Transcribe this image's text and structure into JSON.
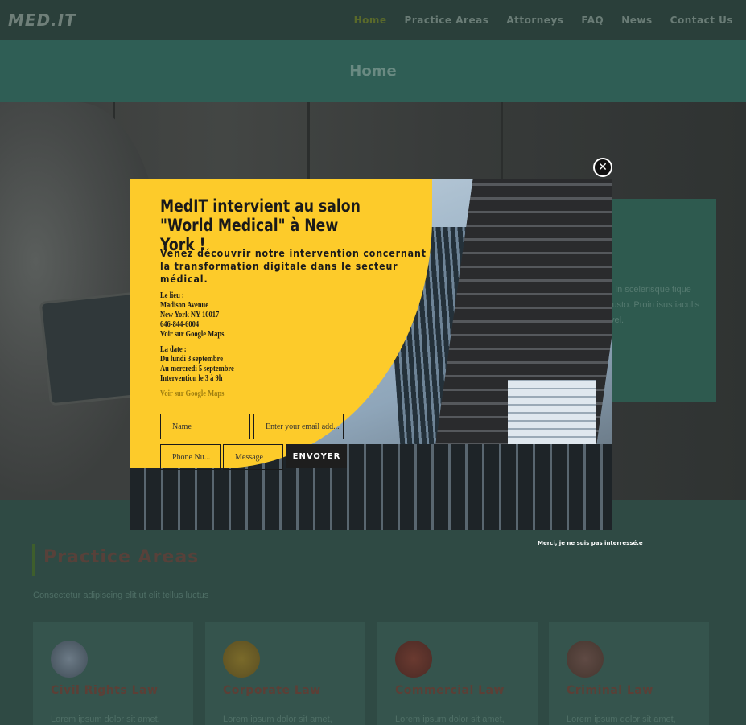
{
  "header": {
    "logo": "MED.IT",
    "nav": [
      "Home",
      "Practice Areas",
      "Attorneys",
      "FAQ",
      "News",
      "Contact Us"
    ],
    "active_nav": "Home"
  },
  "page_title": "Home",
  "hero_card": {
    "text": ". In scelerisque tique justo. Proin isus iaculis vel."
  },
  "practice": {
    "title": "Practice Areas",
    "subtitle": "Consectetur adipiscing elit ut elit tellus luctus",
    "cards": [
      {
        "title": "Civil Rights Law",
        "desc": "Lorem ipsum dolor sit amet,",
        "icon": "dove-icon"
      },
      {
        "title": "Corporate Law",
        "desc": "Lorem ipsum dolor sit amet,",
        "icon": "scales-icon"
      },
      {
        "title": "Commercial Law",
        "desc": "Lorem ipsum dolor sit amet,",
        "icon": "seal-icon"
      },
      {
        "title": "Criminal Law",
        "desc": "Lorem ipsum dolor sit amet,",
        "icon": "gavel-icon"
      }
    ]
  },
  "popup": {
    "title": "MedIT intervient au salon \"World Medical\" à New York !",
    "lead": "Venez découvrir notre intervention concernant la transformation digitale dans le secteur médical.",
    "place_label": "Le lieu :",
    "place_lines": [
      "Madison Avenue",
      "New York NY 10017",
      "646-844-6004",
      "Voir sur Google Maps"
    ],
    "date_label": "La date :",
    "date_lines": [
      "Du lundi 3 septembre",
      "Au mercredi 5 septembre",
      "Intervention le 3 à 9h"
    ],
    "maps_link": "Voir sur Google Maps",
    "fields": {
      "name_placeholder": "Name",
      "email_placeholder": "Enter your email add...",
      "phone_placeholder": "Phone Nu...",
      "message_placeholder": "Message"
    },
    "submit_label": "ENVOYER",
    "close_symbol": "✕",
    "decline_text": "Merci, je ne suis pas interressé.e"
  },
  "colors": {
    "popup_yellow": "#fdcb2a",
    "overlay_teal": "#2f5e55"
  }
}
